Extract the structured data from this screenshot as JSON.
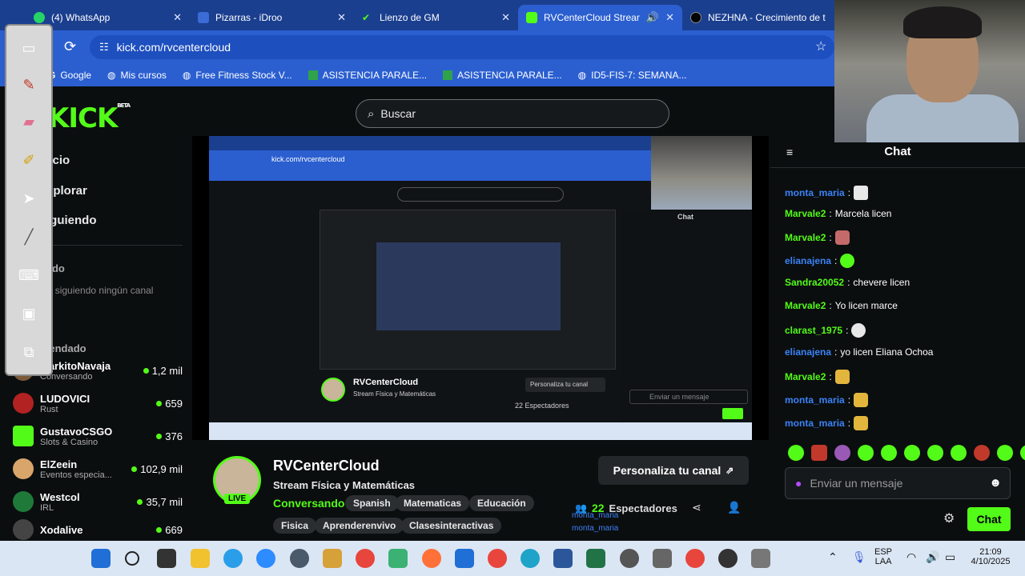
{
  "tabs": [
    {
      "title": "(4) WhatsApp",
      "color": "#25d366"
    },
    {
      "title": "Pizarras - iDroo",
      "color": "#3a6bd6"
    },
    {
      "title": "Lienzo de GM",
      "color": "#53fc18"
    },
    {
      "title": "RVCenterCloud Stream",
      "color": "#53fc18"
    },
    {
      "title": "NEZHNA - Crecimiento de t",
      "color": "#111111"
    }
  ],
  "address": {
    "url": "kick.com/rvcentercloud"
  },
  "bookmarks": [
    "Google",
    "Mis cursos",
    "Free Fitness Stock V...",
    "ASISTENCIA PARALE...",
    "ASISTENCIA PARALE...",
    "ID5-FIS-7: SEMANA..."
  ],
  "sidebar": {
    "logo": "KICK",
    "logo_beta": "BETA",
    "nav": [
      "Inicio",
      "Explorar",
      "Siguiendo"
    ],
    "following_title": "Siguiendo",
    "following_empty": "No estás siguiendo ningún canal",
    "recommended_title": "Recomendado",
    "channels": [
      {
        "name": "MarkitoNavaja",
        "game": "Conversando",
        "viewers": "1,2 mil",
        "color": "#7a5a3a"
      },
      {
        "name": "LUDOVICI",
        "game": "Rust",
        "viewers": "659",
        "color": "#b22222"
      },
      {
        "name": "GustavoCSGO",
        "game": "Slots & Casino",
        "viewers": "376",
        "color": "#53fc18"
      },
      {
        "name": "ElZeein",
        "game": "Eventos especia...",
        "viewers": "102,9 mil",
        "color": "#d9a56b"
      },
      {
        "name": "Westcol",
        "game": "IRL",
        "viewers": "35,7 mil",
        "color": "#1f7a3a"
      },
      {
        "name": "Xodalive",
        "game": "",
        "viewers": "669",
        "color": "#444444"
      }
    ]
  },
  "search": {
    "placeholder": "Buscar"
  },
  "video": {
    "inner_url": "kick.com/rvcentercloud",
    "inner_streamer": "RVCenterCloud",
    "inner_title": "Stream Física y Matemáticas",
    "inner_viewers": "22 Espectadores",
    "inner_customize": "Personaliza tu canal",
    "inner_chat": "Chat",
    "inner_send": "Enviar un mensaje"
  },
  "streamer": {
    "name": "RVCenterCloud",
    "title": "Stream Física y Matemáticas",
    "category": "Conversando",
    "live": "LIVE",
    "tags": [
      "Spanish",
      "Matematicas",
      "Educación",
      "Fisica",
      "Aprenderenvivo",
      "Clasesinteractivas"
    ],
    "customize": "Personaliza tu canal",
    "viewers_count": "22",
    "viewers_label": "Espectadores",
    "overlay_user": "monta_maria"
  },
  "chat": {
    "title": "Chat",
    "messages": [
      {
        "user": "monta_maria",
        "text": "",
        "color": "#3b82f6",
        "emoji": true
      },
      {
        "user": "Marvale2",
        "text": "Marcela licen",
        "color": "#53fc18",
        "emoji": false
      },
      {
        "user": "Marvale2",
        "text": "",
        "color": "#53fc18",
        "emoji": true
      },
      {
        "user": "elianajena",
        "text": "",
        "color": "#3b82f6",
        "emoji": true
      },
      {
        "user": "Sandra20052",
        "text": "chevere licen",
        "color": "#53fc18",
        "emoji": false
      },
      {
        "user": "Marvale2",
        "text": "Yo licen marce",
        "color": "#53fc18",
        "emoji": false
      },
      {
        "user": "clarast_1975",
        "text": "",
        "color": "#53fc18",
        "emoji": true
      },
      {
        "user": "elianajena",
        "text": "yo licen Eliana Ochoa",
        "color": "#3b82f6",
        "emoji": false
      },
      {
        "user": "Marvale2",
        "text": "",
        "color": "#53fc18",
        "emoji": true
      },
      {
        "user": "monta_maria",
        "text": "",
        "color": "#3b82f6",
        "emoji": true
      },
      {
        "user": "monta_maria",
        "text": "",
        "color": "#3b82f6",
        "emoji": true
      }
    ],
    "input_placeholder": "Enviar un mensaje",
    "send_label": "Chat"
  },
  "taskbar": {
    "lang": "ESP",
    "lang2": "LAA",
    "time": "21:09",
    "date": "4/10/2025"
  }
}
